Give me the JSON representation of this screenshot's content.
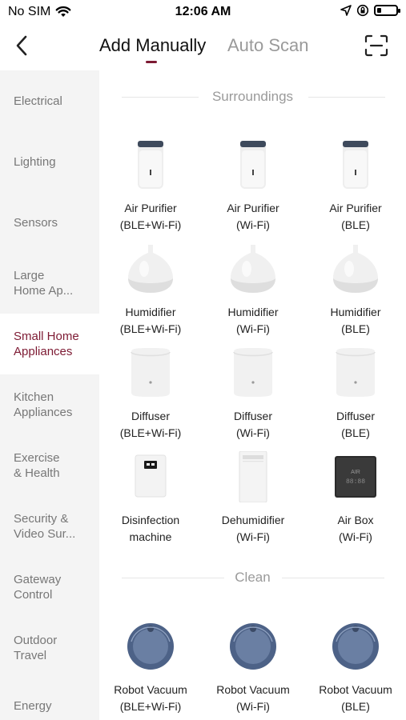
{
  "status_bar": {
    "carrier": "No SIM",
    "time": "12:06 AM"
  },
  "header": {
    "tabs": [
      {
        "label": "Add Manually",
        "active": true
      },
      {
        "label": "Auto Scan",
        "active": false
      }
    ],
    "accent_color": "#7d1a33"
  },
  "sidebar": {
    "items": [
      {
        "label": "Electrical"
      },
      {
        "label": "Lighting"
      },
      {
        "label": "Sensors"
      },
      {
        "label": "Large\nHome Ap..."
      },
      {
        "label": "Small Home\nAppliances",
        "active": true
      },
      {
        "label": "Kitchen\nAppliances"
      },
      {
        "label": "Exercise\n& Health"
      },
      {
        "label": "Security &\nVideo Sur..."
      },
      {
        "label": "Gateway\nControl"
      },
      {
        "label": "Outdoor\nTravel"
      },
      {
        "label": "Energy"
      }
    ]
  },
  "sections": [
    {
      "title": "Surroundings",
      "devices": [
        {
          "name": "Air Purifier",
          "variant": "(BLE+Wi-Fi)",
          "icon": "air-purifier"
        },
        {
          "name": "Air Purifier",
          "variant": "(Wi-Fi)",
          "icon": "air-purifier"
        },
        {
          "name": "Air Purifier",
          "variant": "(BLE)",
          "icon": "air-purifier"
        },
        {
          "name": "Humidifier",
          "variant": "(BLE+Wi-Fi)",
          "icon": "humidifier"
        },
        {
          "name": "Humidifier",
          "variant": "(Wi-Fi)",
          "icon": "humidifier"
        },
        {
          "name": "Humidifier",
          "variant": "(BLE)",
          "icon": "humidifier"
        },
        {
          "name": "Diffuser",
          "variant": "(BLE+Wi-Fi)",
          "icon": "diffuser"
        },
        {
          "name": "Diffuser",
          "variant": "(Wi-Fi)",
          "icon": "diffuser"
        },
        {
          "name": "Diffuser",
          "variant": "(BLE)",
          "icon": "diffuser"
        },
        {
          "name": "Disinfection",
          "variant": "machine",
          "icon": "disinfection-machine"
        },
        {
          "name": "Dehumidifier",
          "variant": "(Wi-Fi)",
          "icon": "dehumidifier"
        },
        {
          "name": "Air Box",
          "variant": "(Wi-Fi)",
          "icon": "air-box",
          "icon_text": "AIR",
          "icon_digits": "88:88"
        }
      ]
    },
    {
      "title": "Clean",
      "devices": [
        {
          "name": "Robot Vacuum",
          "variant": "(BLE+Wi-Fi)",
          "icon": "robot-vacuum"
        },
        {
          "name": "Robot Vacuum",
          "variant": "(Wi-Fi)",
          "icon": "robot-vacuum"
        },
        {
          "name": "Robot Vacuum",
          "variant": "(BLE)",
          "icon": "robot-vacuum"
        }
      ]
    }
  ]
}
